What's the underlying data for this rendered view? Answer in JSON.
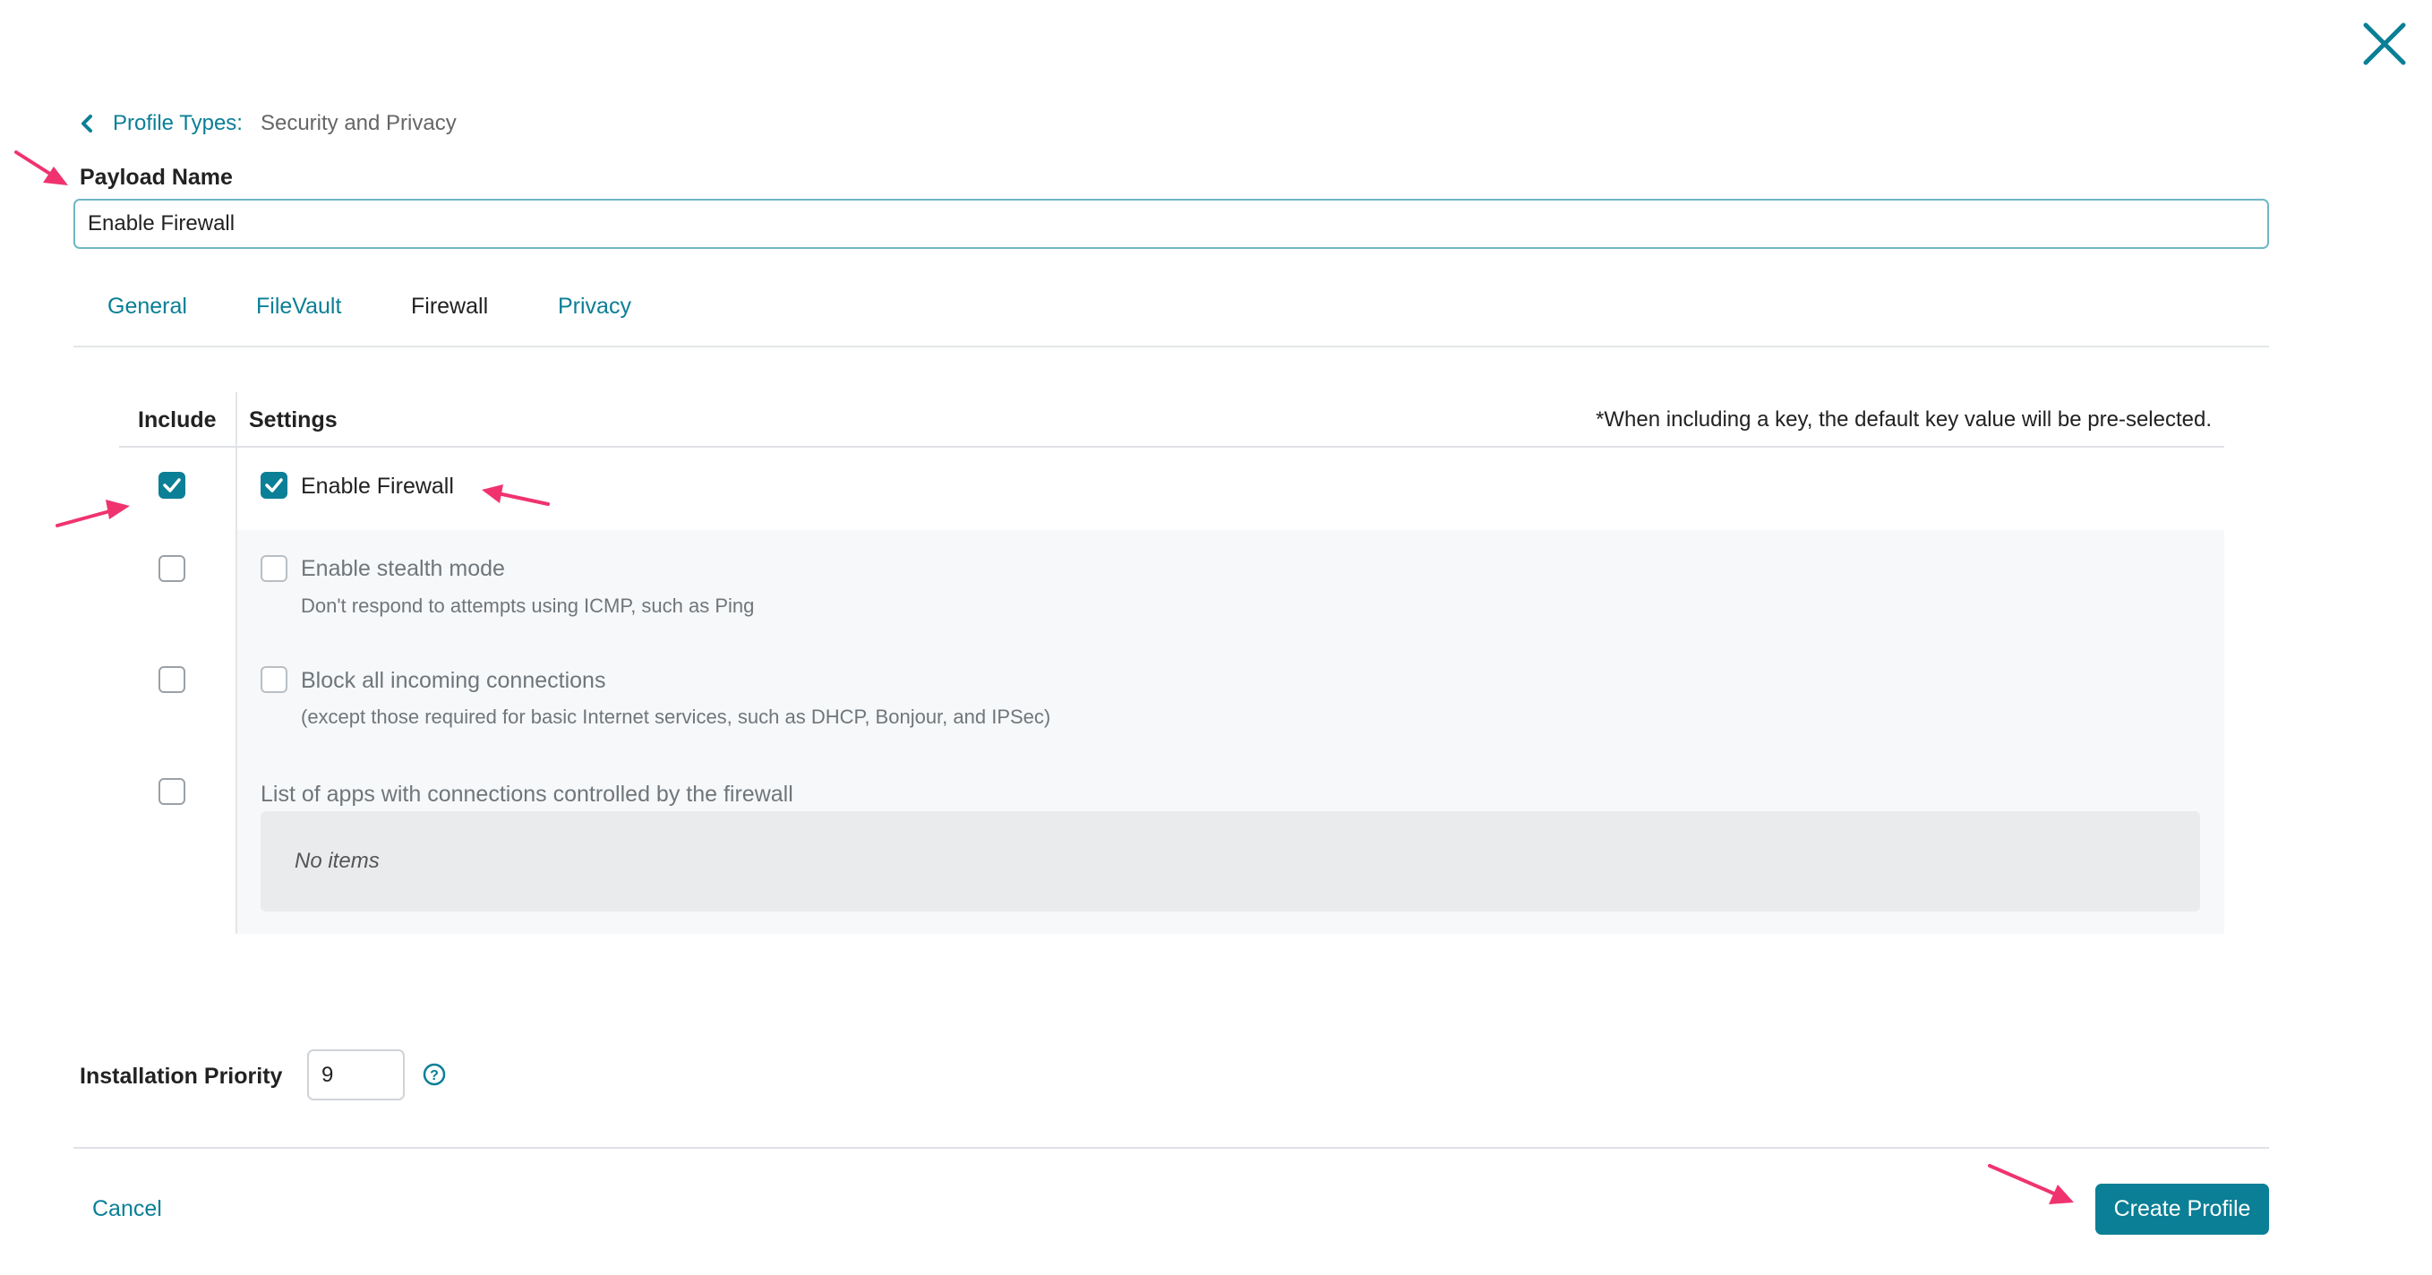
{
  "breadcrumb": {
    "link_label": "Profile Types:",
    "current": "Security and Privacy"
  },
  "payload": {
    "label": "Payload Name",
    "value": "Enable Firewall"
  },
  "tabs": [
    {
      "label": "General",
      "active": false
    },
    {
      "label": "FileVault",
      "active": false
    },
    {
      "label": "Firewall",
      "active": true
    },
    {
      "label": "Privacy",
      "active": false
    }
  ],
  "table": {
    "include_header": "Include",
    "settings_header": "Settings",
    "note": "*When including a key, the default key value will be pre-selected.",
    "rows": [
      {
        "include": true,
        "label": "Enable Firewall",
        "checked": true,
        "description": ""
      },
      {
        "include": false,
        "label": "Enable stealth mode",
        "checked": false,
        "description": "Don't respond to attempts using ICMP, such as Ping"
      },
      {
        "include": false,
        "label": "Block all incoming connections",
        "checked": false,
        "description": "(except those required for basic Internet services, such as DHCP, Bonjour, and IPSec)"
      },
      {
        "include": false,
        "label": "List of apps with connections controlled by the firewall",
        "empty_text": "No items"
      }
    ]
  },
  "priority": {
    "label": "Installation Priority",
    "value": "9"
  },
  "footer": {
    "cancel_label": "Cancel",
    "create_label": "Create Profile"
  },
  "colors": {
    "accent": "#0a7f96",
    "annotation": "#f0336f"
  },
  "icons": [
    "close-icon",
    "chevron-left-icon",
    "help-icon",
    "checkmark-icon",
    "annotation-arrow"
  ]
}
